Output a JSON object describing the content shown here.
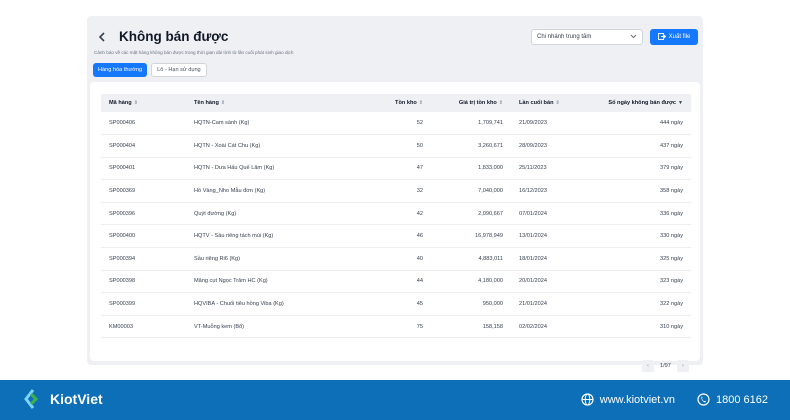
{
  "header": {
    "title": "Không bán được",
    "subtitle": "Cảnh báo về các mặt hàng không bán được trong thời gian dài tính từ lần cuối phát sinh giao dịch",
    "branch_select": "Chi nhánh trung tâm",
    "export_label": "Xuất file"
  },
  "tabs": [
    {
      "label": "Hàng hóa thường"
    },
    {
      "label": "Lô - Hạn sử dụng"
    }
  ],
  "table": {
    "columns": [
      "Mã hàng",
      "Tên hàng",
      "Tồn kho",
      "Giá trị tồn kho",
      "Lần cuối bán",
      "Số ngày không bán được"
    ],
    "rows": [
      [
        "SP000406",
        "HQTN-Cam sành (Kg)",
        "52",
        "1,709,741",
        "21/09/2023",
        "444 ngày"
      ],
      [
        "SP000404",
        "HQTN - Xoài Cát Chu (Kg)",
        "50",
        "3,260,671",
        "28/09/2023",
        "437 ngày"
      ],
      [
        "SP000401",
        "HQTN - Dưa Hấu Quế Lâm (Kg)",
        "47",
        "1,833,000",
        "25/11/2023",
        "379 ngày"
      ],
      [
        "SP000369",
        "Hồ Vàng_Nho Mẫu đơn (Kg)",
        "32",
        "7,040,000",
        "16/12/2023",
        "358 ngày"
      ],
      [
        "SP000396",
        "Quýt đường (Kg)",
        "42",
        "2,090,667",
        "07/01/2024",
        "336 ngày"
      ],
      [
        "SP000400",
        "HQTV - Sầu riêng tách múi (Kg)",
        "46",
        "16,978,949",
        "13/01/2024",
        "330 ngày"
      ],
      [
        "SP000394",
        "Sầu riêng Ri6 (Kg)",
        "40",
        "4,883,011",
        "18/01/2024",
        "325 ngày"
      ],
      [
        "SP000398",
        "Măng cụt Ngọc Trâm HC (Kg)",
        "44",
        "4,180,000",
        "20/01/2024",
        "323 ngày"
      ],
      [
        "SP000399",
        "HQVIBA - Chuối tiêu hồng Viba (Kg)",
        "45",
        "950,000",
        "21/01/2024",
        "322 ngày"
      ],
      [
        "KM00003",
        "VT-Muỗng kem (Bổ)",
        "75",
        "158,158",
        "02/02/2024",
        "310 ngày"
      ]
    ]
  },
  "pagination": {
    "label": "1/97"
  },
  "footer": {
    "brand": "KiotViet",
    "website": "www.kiotviet.vn",
    "phone": "1800 6162"
  },
  "colors": {
    "accent": "#1677ff",
    "footer": "#0c6fb8"
  }
}
